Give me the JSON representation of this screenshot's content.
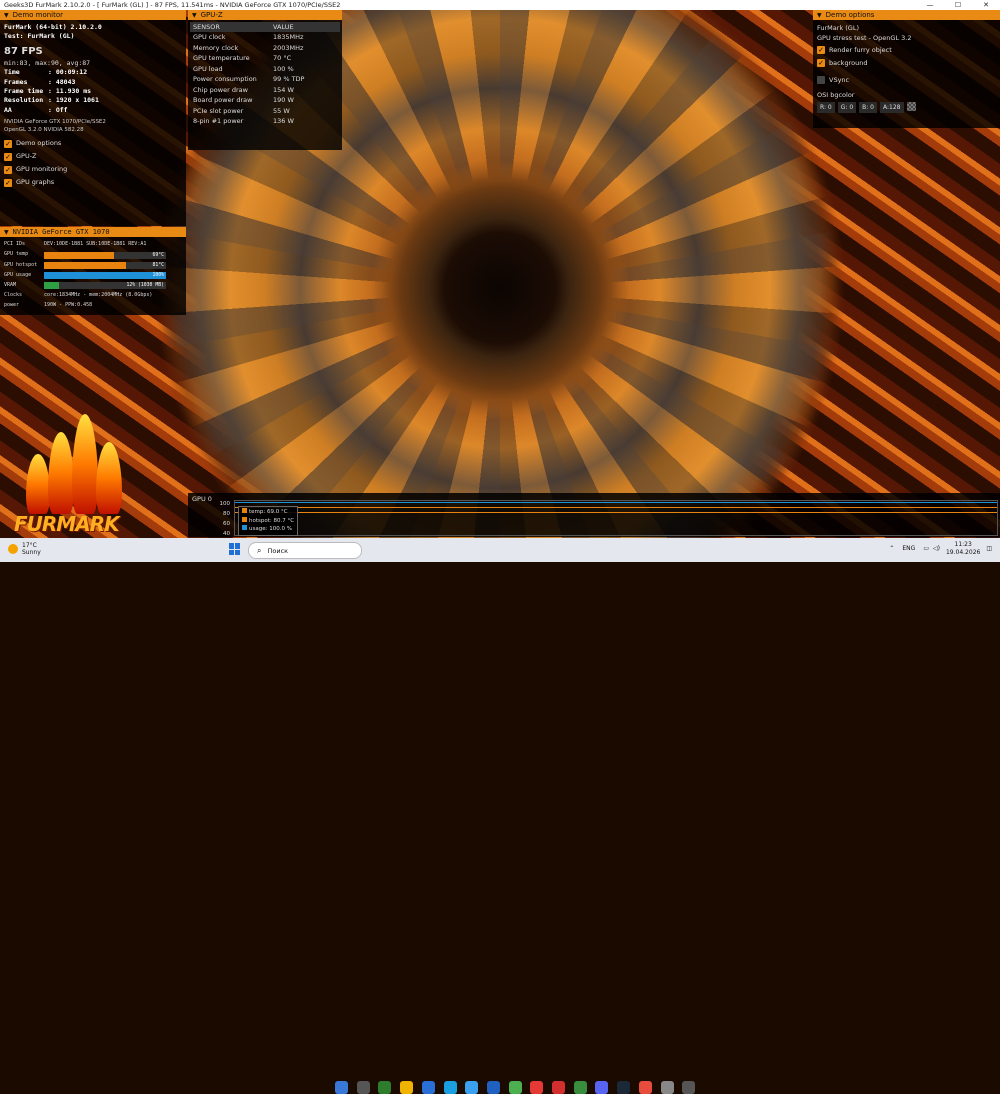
{
  "window": {
    "title": "Geeks3D FurMark 2.10.2.0 - [ FurMark (GL) ] - 87 FPS, 11.541ms - NVIDIA GeForce GTX 1070/PCIe/SSE2",
    "minimize": "—",
    "maximize": "☐",
    "close": "✕"
  },
  "demo_monitor": {
    "header": "Demo monitor",
    "app": "FurMark (64-bit) 2.10.2.0",
    "test": "Test: FurMark (GL)",
    "fps": "87 FPS",
    "fps_stats": "min:83, max:90, avg:87",
    "stats": [
      {
        "k": "Time",
        "v": ": 00:09:12"
      },
      {
        "k": "Frames",
        "v": ": 48043"
      },
      {
        "k": "Frame time",
        "v": ": 11.930 ms"
      },
      {
        "k": "Resolution",
        "v": ": 1920 x 1061"
      },
      {
        "k": "AA",
        "v": ": Off"
      }
    ],
    "gpu_line1": "NVIDIA GeForce GTX 1070/PCIe/SSE2",
    "gpu_line2": "OpenGL 3.2.0 NVIDIA 582.28",
    "checks": [
      "Demo options",
      "GPU-Z",
      "GPU monitoring",
      "GPU graphs"
    ]
  },
  "gpu_panel": {
    "header": "NVIDIA GeForce GTX 1070",
    "pci_label": "PCI IDs",
    "pci_value": "DEV:10DE-1B81 SUB:10DE-1B81 REV:A1",
    "bars": [
      {
        "label": "GPU temp",
        "value": "69°C",
        "fraction": 0.57,
        "color": "#e8830f"
      },
      {
        "label": "GPU hotspot",
        "value": "81°C",
        "fraction": 0.67,
        "color": "#e8830f"
      },
      {
        "label": "GPU usage",
        "value": "100%",
        "fraction": 1.0,
        "color": "#1f8fd6"
      },
      {
        "label": "VRAM",
        "value": "12% (1030 MB)",
        "fraction": 0.12,
        "color": "#2ea043"
      }
    ],
    "clocks_label": "Clocks",
    "clocks_value": "core:1834MHz - mem:2004MHz (8.0Gbps)",
    "power_label": "power",
    "power_value": "190W - PPW:0.458"
  },
  "gpuz": {
    "header": "GPU-Z",
    "col_sensor": "SENSOR",
    "col_value": "VALUE",
    "rows": [
      [
        "GPU clock",
        "1835MHz"
      ],
      [
        "Memory clock",
        "2003MHz"
      ],
      [
        "GPU temperature",
        "70 °C"
      ],
      [
        "GPU load",
        "100 %"
      ],
      [
        "Power consumption",
        "99 % TDP"
      ],
      [
        "Chip power draw",
        "154 W"
      ],
      [
        "Board power draw",
        "190 W"
      ],
      [
        "PCIe slot power",
        "55 W"
      ],
      [
        "8-pin #1 power",
        "136 W"
      ]
    ]
  },
  "demo_options": {
    "header": "Demo options",
    "title": "FurMark (GL)",
    "subtitle": "GPU stress test - OpenGL 3.2",
    "checks": [
      {
        "label": "Render furry object",
        "on": true
      },
      {
        "label": "background",
        "on": true
      },
      {
        "label": "VSync",
        "on": false
      }
    ],
    "bgcolor_label": "OSI bgcolor",
    "swatches": [
      "R: 0",
      "G: 0",
      "B: 0",
      "A:128"
    ]
  },
  "graph": {
    "title": "GPU 0",
    "yticks": [
      "100",
      "80",
      "60",
      "40"
    ],
    "legend": [
      {
        "label": "temp: 69.0 °C",
        "color": "#e8830f"
      },
      {
        "label": "hotspot: 80.7 °C",
        "color": "#e8830f"
      },
      {
        "label": "usage: 100.0 %",
        "color": "#1f8fd6"
      }
    ]
  },
  "logo": {
    "text": "FURMARK"
  },
  "taskbar": {
    "temp": "17°C",
    "weather": "Sunny",
    "search_placeholder": "Поиск",
    "lang": "ENG",
    "time": "11:23",
    "date": "19.04.2026",
    "app_icon_colors": [
      "#3a78d8",
      "#555",
      "#2d7d2d",
      "#f0b400",
      "#2a6fd6",
      "#1aa0e0",
      "#3ca0f0",
      "#2060c0",
      "#4caf50",
      "#e53935",
      "#d32f2f",
      "#388e3c",
      "#5865f2",
      "#1b2838",
      "#e74c3c",
      "#888",
      "#555"
    ]
  }
}
